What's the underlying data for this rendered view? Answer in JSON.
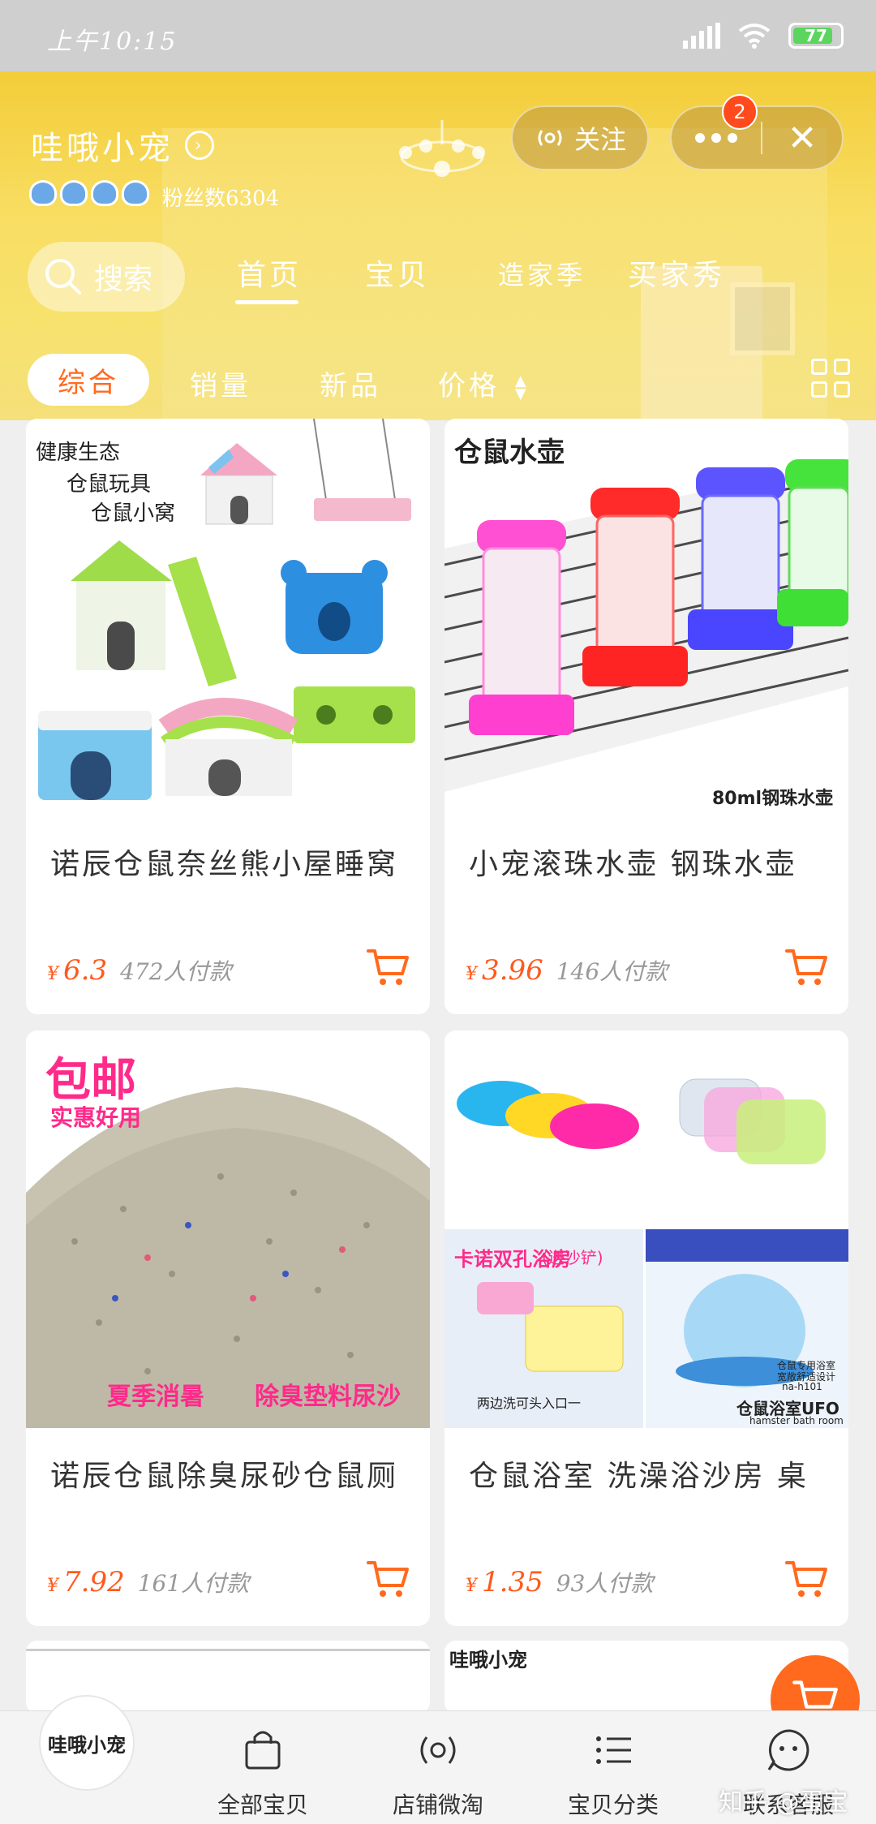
{
  "status_bar": {
    "time": "上午10:15",
    "battery": "77"
  },
  "shop": {
    "name": "哇哦小宠",
    "fans_label": "粉丝数6304",
    "follow_label": "关注",
    "notification_count": "2",
    "search_label": "搜索"
  },
  "tabs": [
    {
      "label": "首页",
      "active": true
    },
    {
      "label": "宝贝",
      "active": false
    },
    {
      "label": "造家季",
      "active": false
    },
    {
      "label": "买家秀",
      "active": false
    }
  ],
  "sort": {
    "items": [
      "综合",
      "销量",
      "新品",
      "价格"
    ],
    "active": "综合"
  },
  "products": [
    {
      "title": "诺辰仓鼠奈丝熊小屋睡窝",
      "price_symbol": "¥",
      "price": "6.3",
      "pay_count": "472人付款",
      "image_text": [
        "健康生态",
        "仓鼠玩具",
        "仓鼠小窝"
      ]
    },
    {
      "title": "小宠滚珠水壶 钢珠水壶",
      "price_symbol": "¥",
      "price": "3.96",
      "pay_count": "146人付款",
      "image_text": [
        "仓鼠水壶",
        "80ml钢珠水壶"
      ]
    },
    {
      "title": "诺辰仓鼠除臭尿砂仓鼠厕",
      "price_symbol": "¥",
      "price": "7.92",
      "pay_count": "161人付款",
      "image_text": [
        "包邮",
        "实惠好用",
        "夏季消暑",
        "除臭垫料尿沙"
      ]
    },
    {
      "title": "仓鼠浴室 洗澡浴沙房 桌",
      "price_symbol": "¥",
      "price": "1.35",
      "pay_count": "93人付款",
      "image_text": [
        "卡诺双孔浴房",
        "(送沙铲)",
        "两边洗可头入口一",
        "仓鼠浴室UFO",
        "hamster bath room",
        "仓鼠专用浴室",
        "宽敞舒适设计",
        "na-h101"
      ]
    }
  ],
  "partial_cards": {
    "right_label": "哇哦小宠"
  },
  "bottom_nav": {
    "logo_text": "哇哦小宠",
    "items": [
      "全部宝贝",
      "店铺微淘",
      "宝贝分类",
      "联系客服"
    ]
  },
  "watermark": "知乎 @蛋宝",
  "colors": {
    "accent": "#ff6a1e",
    "header": "#f5d74e"
  }
}
